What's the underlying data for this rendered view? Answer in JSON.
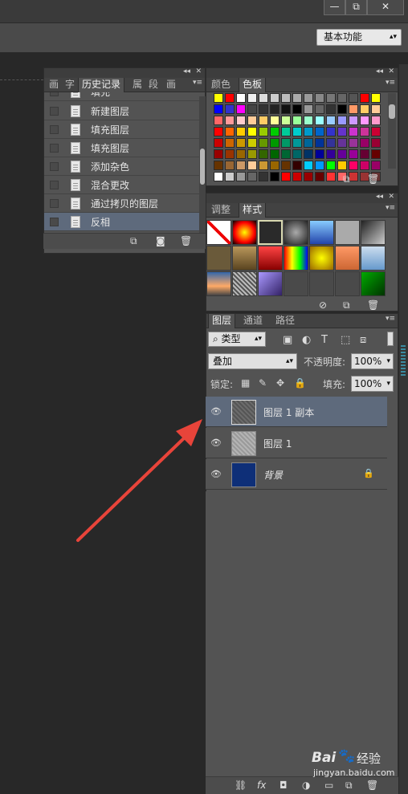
{
  "window": {
    "minimize": "—",
    "restore": "⧉",
    "close": "✕"
  },
  "workspace": {
    "value": "基本功能"
  },
  "history_panel": {
    "tabs": [
      "画",
      "字",
      "历史记录",
      "属",
      "段",
      "画"
    ],
    "items": [
      {
        "label": "填充"
      },
      {
        "label": "新建图层"
      },
      {
        "label": "填充图层"
      },
      {
        "label": "填充图层"
      },
      {
        "label": "添加杂色"
      },
      {
        "label": "混合更改"
      },
      {
        "label": "通过拷贝的图层"
      },
      {
        "label": "反相",
        "selected": true
      }
    ],
    "bottom_icons": [
      "new-document-icon",
      "camera-icon",
      "trash-icon"
    ]
  },
  "swatches_panel": {
    "tabs": [
      "颜色",
      "色板"
    ]
  },
  "styles_panel": {
    "tabs": [
      "调整",
      "样式"
    ]
  },
  "layers_panel": {
    "tabs": [
      "图层",
      "通道",
      "路径"
    ],
    "filter_label": "类型",
    "blend_mode": "叠加",
    "opacity_label": "不透明度:",
    "opacity_value": "100%",
    "lock_label": "锁定:",
    "fill_label": "填充:",
    "fill_value": "100%",
    "layers": [
      {
        "name": "图层 1 副本",
        "selected": true
      },
      {
        "name": "图层 1"
      },
      {
        "name": "背景",
        "locked": true
      }
    ],
    "bottom_icons": [
      "link-icon",
      "fx-icon",
      "mask-icon",
      "adjustment-icon",
      "folder-icon",
      "new-layer-icon",
      "trash-icon"
    ],
    "fx_label": "fx"
  },
  "watermark": {
    "brand": "Bai",
    "brand2": "经验",
    "url": "jingyan.baidu.com"
  },
  "colors": {
    "selection": "#5e6a7c",
    "panel": "#535353",
    "arrow": "#e8443a"
  }
}
